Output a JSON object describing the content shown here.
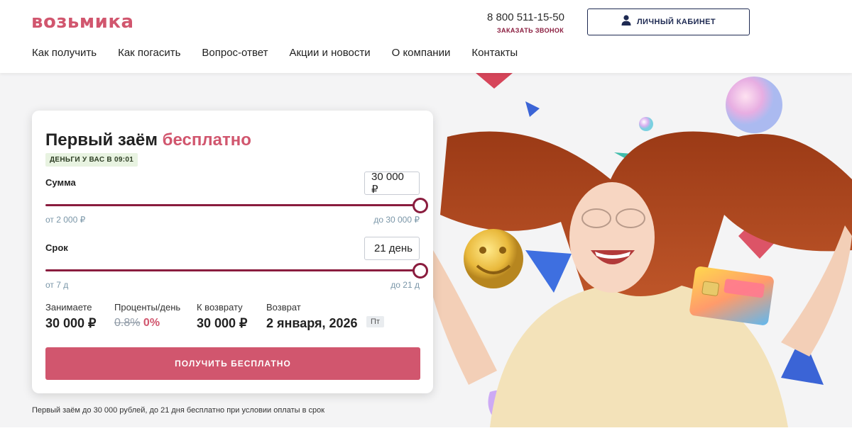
{
  "brand": {
    "logo": "возьмика",
    "accent": "#d1566e",
    "dark": "#8a1c3e",
    "navy": "#1e2a52"
  },
  "header": {
    "phone": "8 800 511-15-50",
    "callback": "ЗАКАЗАТЬ ЗВОНОК",
    "cabinet": {
      "icon": "user-icon",
      "label": "ЛИЧНЫЙ КАБИНЕТ"
    },
    "nav": [
      "Как получить",
      "Как погасить",
      "Вопрос-ответ",
      "Акции и новости",
      "О компании",
      "Контакты"
    ]
  },
  "calculator": {
    "title_prefix": "Первый заём ",
    "title_accent": "бесплатно",
    "badge": "ДЕНЬГИ У ВАС В 09:01",
    "amount": {
      "label": "Сумма",
      "value": "30 000 ₽",
      "min_label": "от 2 000 ₽",
      "max_label": "до 30 000 ₽",
      "min": 2000,
      "max": 30000,
      "current": 30000
    },
    "term": {
      "label": "Срок",
      "value": "21 день",
      "min_label": "от 7 д",
      "max_label": "до 21 д",
      "min": 7,
      "max": 21,
      "current": 21
    },
    "summary": {
      "borrow_label": "Занимаете",
      "borrow_value": "30 000 ₽",
      "rate_label": "Проценты/день",
      "rate_old": "0.8%",
      "rate_new": "0%",
      "repay_label": "К возврату",
      "repay_value": "30 000 ₽",
      "return_label": "Возврат",
      "return_date": "2 января, 2026",
      "return_weekday": "Пт"
    },
    "cta": "ПОЛУЧИТЬ БЕСПЛАТНО"
  },
  "footnote": "Первый заём до 30 000 рублей, до 21 дня бесплатно при условии оплаты в срок"
}
